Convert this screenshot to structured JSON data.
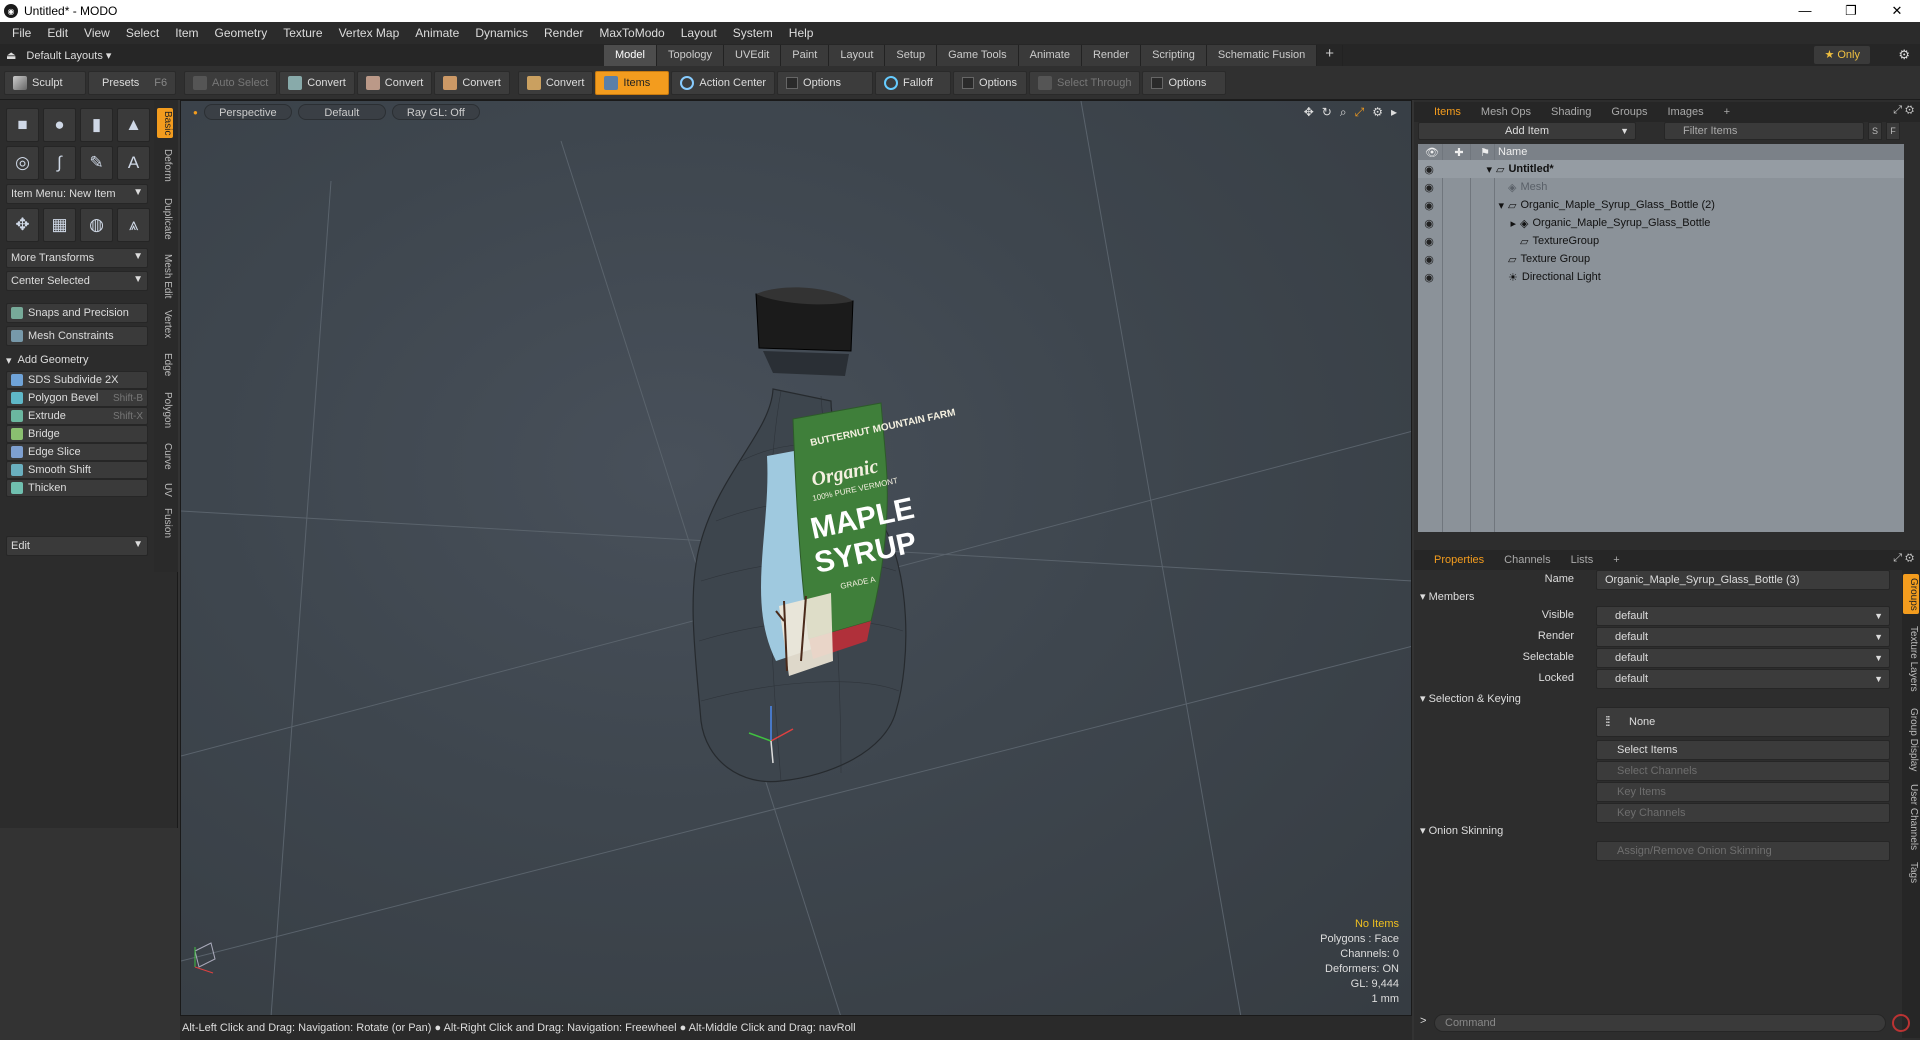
{
  "window": {
    "title": "Untitled* - MODO",
    "minimize": "—",
    "maximize": "❐",
    "close": "✕"
  },
  "menu": [
    "File",
    "Edit",
    "View",
    "Select",
    "Item",
    "Geometry",
    "Texture",
    "Vertex Map",
    "Animate",
    "Dynamics",
    "Render",
    "MaxToModo",
    "Layout",
    "System",
    "Help"
  ],
  "layout_bar": {
    "default_layouts": "Default Layouts ▾",
    "tabs": [
      "Model",
      "Topology",
      "UVEdit",
      "Paint",
      "Layout",
      "Setup",
      "Game Tools",
      "Animate",
      "Render",
      "Scripting",
      "Schematic Fusion"
    ],
    "active_tab": "Model",
    "only_label": "★  Only"
  },
  "toolbar": {
    "sculpt": "Sculpt",
    "presets": "Presets",
    "presets_key": "F6",
    "auto_select": "Auto Select",
    "convert1": "Convert",
    "convert2": "Convert",
    "convert3": "Convert",
    "convert4": "Convert",
    "items": "Items",
    "action_center": "Action Center",
    "options1": "Options",
    "falloff": "Falloff",
    "options2": "Options",
    "select_through": "Select Through",
    "options3": "Options"
  },
  "left_panel": {
    "vertical_tabs": [
      "Basic",
      "Deform",
      "Duplicate",
      "Mesh Edit",
      "Vertex",
      "Edge",
      "Polygon",
      "Curve",
      "UV",
      "Fusion"
    ],
    "item_menu": "Item Menu: New Item",
    "more_transforms": "More Transforms",
    "center_selected": "Center Selected",
    "snaps": "Snaps and Precision",
    "mesh_constraints": "Mesh Constraints",
    "add_geometry": "Add Geometry",
    "tools": [
      {
        "label": "SDS Subdivide 2X",
        "key": ""
      },
      {
        "label": "Polygon Bevel",
        "key": "Shift-B"
      },
      {
        "label": "Extrude",
        "key": "Shift-X"
      },
      {
        "label": "Bridge",
        "key": ""
      },
      {
        "label": "Edge Slice",
        "key": ""
      },
      {
        "label": "Smooth Shift",
        "key": ""
      },
      {
        "label": "Thicken",
        "key": ""
      }
    ],
    "edit": "Edit"
  },
  "viewport": {
    "view": "Perspective",
    "shading": "Default",
    "raygl": "Ray GL: Off",
    "stats": {
      "no_items": "No Items",
      "polygons": "Polygons : Face",
      "channels": "Channels: 0",
      "deformers": "Deformers: ON",
      "gl": "GL: 9,444",
      "unit": "1 mm"
    },
    "label": {
      "brand": "BUTTERNUT MOUNTAIN FARM",
      "organic": "Organic",
      "pure": "100% PURE VERMONT",
      "maple": "MAPLE",
      "syrup": "SYRUP",
      "grade": "GRADE A"
    }
  },
  "status_bar": "Alt-Left Click and Drag: Navigation: Rotate (or Pan) ●  Alt-Right Click and Drag: Navigation: Freewheel ●  Alt-Middle Click and Drag: navRoll",
  "items_panel": {
    "tabs": [
      "Items",
      "Mesh Ops",
      "Shading",
      "Groups",
      "Images",
      "+"
    ],
    "active_tab": "Items",
    "add_item": "Add Item",
    "filter_items": "Filter Items",
    "s": "S",
    "f": "F",
    "col_name": "Name",
    "tree": [
      {
        "label": "Untitled*",
        "indent": 0,
        "bold": true,
        "dim": false,
        "eye": true
      },
      {
        "label": "Mesh",
        "indent": 1,
        "bold": false,
        "dim": true,
        "eye": true
      },
      {
        "label": "Organic_Maple_Syrup_Glass_Bottle (2)",
        "indent": 1,
        "bold": false,
        "dim": false,
        "eye": true
      },
      {
        "label": "Organic_Maple_Syrup_Glass_Bottle",
        "indent": 2,
        "bold": false,
        "dim": false,
        "eye": true
      },
      {
        "label": "TextureGroup",
        "indent": 2,
        "bold": false,
        "dim": false,
        "eye": true
      },
      {
        "label": "Texture Group",
        "indent": 1,
        "bold": false,
        "dim": false,
        "eye": true
      },
      {
        "label": "Directional Light",
        "indent": 1,
        "bold": false,
        "dim": false,
        "eye": true
      }
    ]
  },
  "properties_panel": {
    "tabs": [
      "Properties",
      "Channels",
      "Lists",
      "+"
    ],
    "active_tab": "Properties",
    "name_label": "Name",
    "name_value": "Organic_Maple_Syrup_Glass_Bottle (3)",
    "members": "Members",
    "visible_label": "Visible",
    "visible": "default",
    "render_label": "Render",
    "render": "default",
    "selectable_label": "Selectable",
    "selectable": "default",
    "locked_label": "Locked",
    "locked": "default",
    "selection_keying": "Selection & Keying",
    "none": "None",
    "select_items": "Select Items",
    "select_channels": "Select Channels",
    "key_items": "Key Items",
    "key_channels": "Key Channels",
    "onion_skinning": "Onion Skinning",
    "assign_onion": "Assign/Remove Onion Skinning",
    "side_tabs": [
      "Groups",
      "Texture Layers",
      "Group Display",
      "User Channels",
      "Tags"
    ]
  },
  "command": {
    "prompt": ">",
    "placeholder": "Command"
  },
  "colors": {
    "accent": "#f39c1e",
    "tree_bg": "#8b9299",
    "viewport": "#3e464e"
  }
}
